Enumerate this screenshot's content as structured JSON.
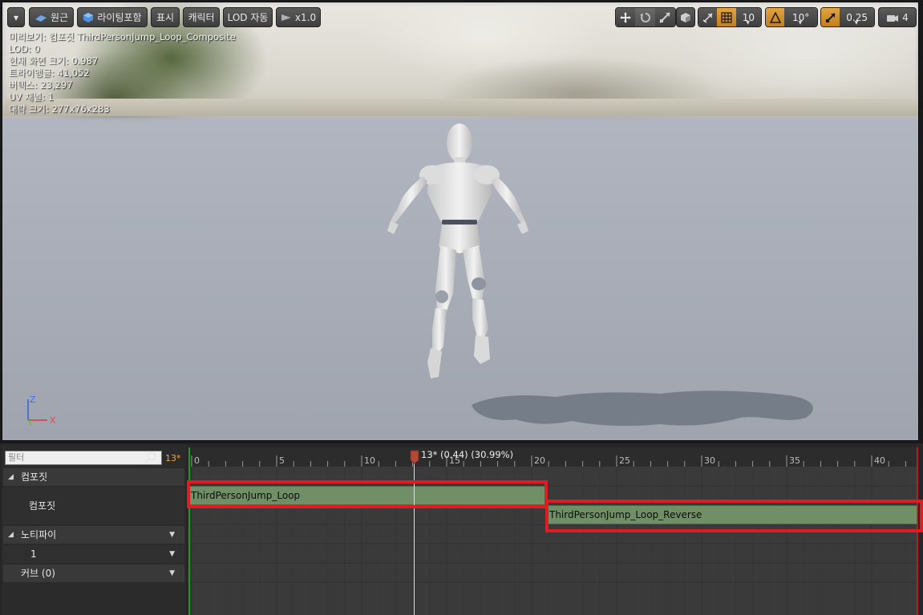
{
  "toolbar": {
    "menu_caret": "▾",
    "perspective_label": "원근",
    "lighting_label": "라이팅포함",
    "show_label": "표시",
    "character_label": "캐릭터",
    "lod_label": "LOD 자동",
    "speed_label": "x1.0",
    "grid_snap_value": "10",
    "rotation_snap_value": "10°",
    "scale_snap_value": "0.25",
    "camera_speed_value": "4"
  },
  "stats": [
    "미리보기: 컴포짓 ThirdPersonJump_Loop_Composite",
    "LOD: 0",
    "현재 화면 크기: 0.987",
    "트라이앵글: 41,052",
    "버텍스: 23,297",
    "UV 채널: 1",
    "대략 크기: 277x76x283"
  ],
  "axis": {
    "z": "Z",
    "x": "X"
  },
  "left_panel": {
    "filter_placeholder": "필터",
    "current_frame": "13*",
    "rows": [
      {
        "label": "컴포짓",
        "arrow": "◢"
      },
      {
        "label": "컴포짓"
      },
      {
        "label": "노티파이",
        "arrow": "◢",
        "dropdown": "▼"
      },
      {
        "label": "1",
        "dropdown": "▼"
      },
      {
        "label": "커브 (0)",
        "dropdown": "▼"
      }
    ]
  },
  "timeline": {
    "ticks": [
      "0",
      "5",
      "10",
      "15",
      "20",
      "25",
      "30",
      "35",
      "40"
    ],
    "playhead_label": "13* (0.44) (30.99%)",
    "segments": [
      "ThirdPersonJump_Loop",
      "ThirdPersonJump_Loop_Reverse"
    ]
  },
  "colors": {
    "accent": "#e2a443",
    "segment": "#718f66",
    "highlight": "#e11b22",
    "playhead": "#b24a3a"
  }
}
